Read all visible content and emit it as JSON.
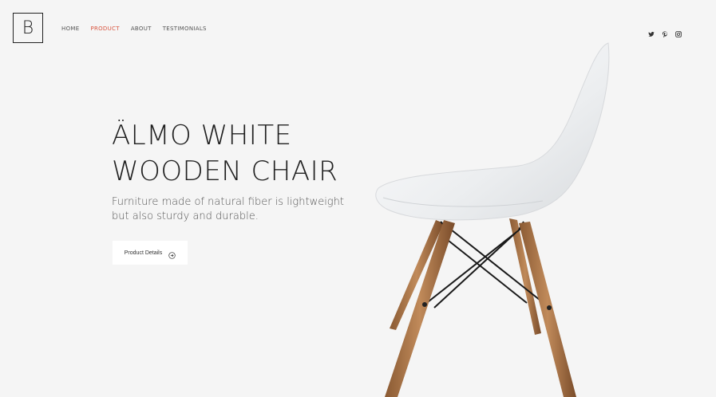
{
  "brand": {
    "logo_letter": "B"
  },
  "nav": {
    "items": [
      {
        "label": "HOME",
        "active": false
      },
      {
        "label": "PRODUCT",
        "active": true
      },
      {
        "label": "ABOUT",
        "active": false
      },
      {
        "label": "TESTIMONIALS",
        "active": false
      }
    ]
  },
  "social": {
    "icons": [
      "twitter-icon",
      "pinterest-icon",
      "instagram-icon"
    ]
  },
  "hero": {
    "title_line1": "ÄLMO WHITE",
    "title_line2": "WOODEN CHAIR",
    "description": "Furniture made of natural fiber is lightweight but also sturdy and durable.",
    "cta_label": "Product Details"
  },
  "colors": {
    "background": "#f5f5f5",
    "accent": "#d9553f",
    "text": "#1f1f1f"
  }
}
